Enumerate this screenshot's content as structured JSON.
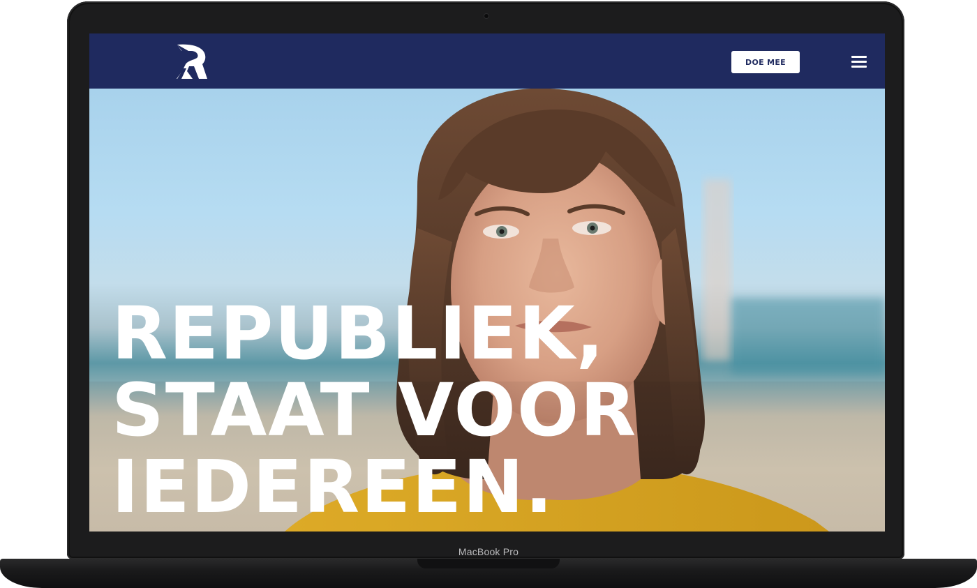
{
  "device": {
    "label": "MacBook Pro"
  },
  "site": {
    "logo_icon": "republiek-r-logo",
    "cta_label": "DOE MEE",
    "menu_icon": "hamburger-menu-icon",
    "nav_color": "#1f2a5f"
  },
  "hero": {
    "headline_lines": [
      "REPUBLIEK,",
      "STAAT VOOR",
      "IEDEREEN."
    ],
    "text_color": "#ffffff"
  }
}
